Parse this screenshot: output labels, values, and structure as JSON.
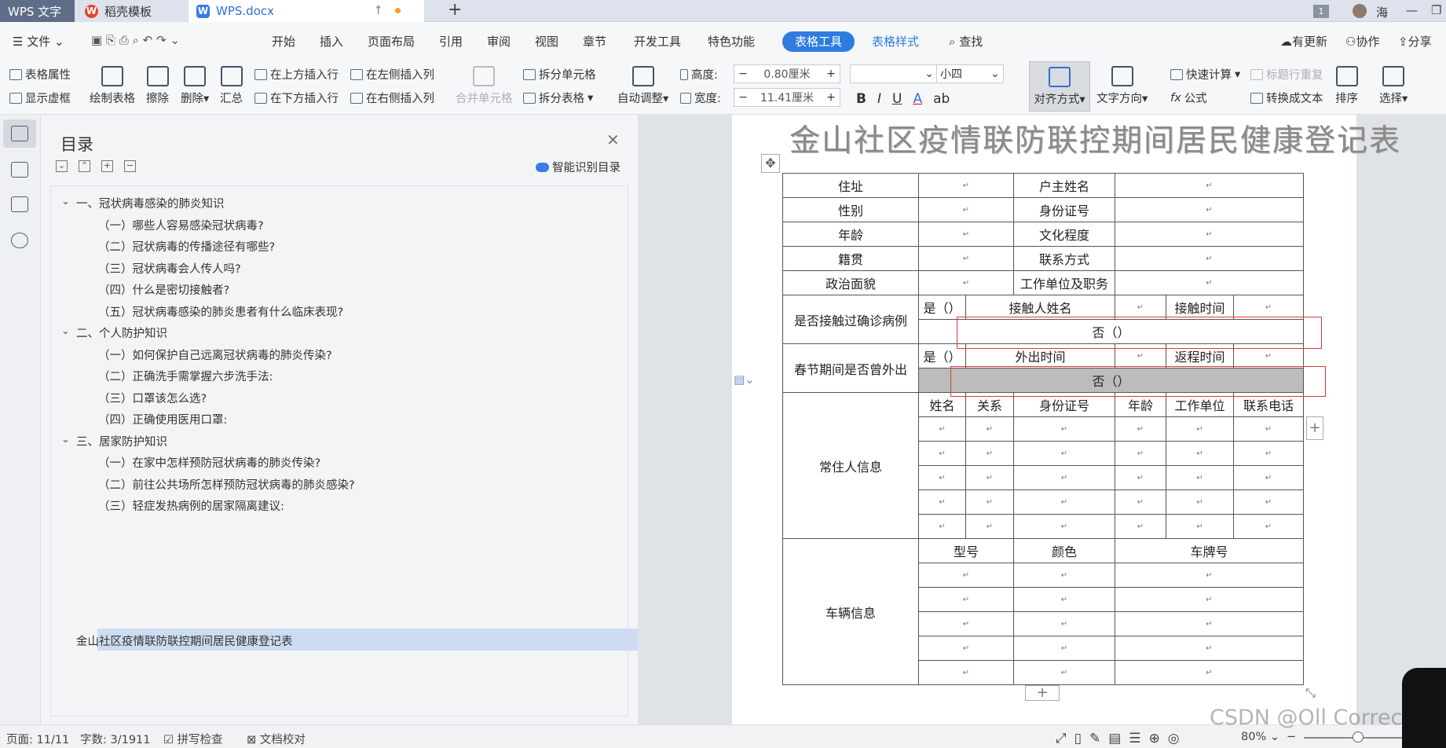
{
  "tabs": {
    "app": "WPS 文字",
    "template": "稻壳模板",
    "doc": "WPS.docx",
    "new_tab": "+",
    "badge": "1",
    "user": "海"
  },
  "menu": {
    "file": "文件",
    "items": [
      "开始",
      "插入",
      "页面布局",
      "引用",
      "审阅",
      "视图",
      "章节",
      "开发工具",
      "特色功能"
    ],
    "active": "表格工具",
    "style": "表格样式",
    "search": "查找",
    "update": "有更新",
    "collab": "协作",
    "share": "分享"
  },
  "ribbon": {
    "table_props": "表格属性",
    "show_grid": "显示虚框",
    "draw": "绘制表格",
    "erase": "擦除",
    "delete": "删除",
    "summary": "汇总",
    "ins_above": "在上方插入行",
    "ins_below": "在下方插入行",
    "ins_left": "在左侧插入列",
    "ins_right": "在右侧插入列",
    "merge": "合并单元格",
    "split_cell": "拆分单元格",
    "split_table": "拆分表格",
    "autofit": "自动调整",
    "height_label": "高度:",
    "height_val": "0.80厘米",
    "width_label": "宽度:",
    "width_val": "11.41厘米",
    "font_size": "小四",
    "align": "对齐方式",
    "text_dir": "文字方向",
    "quick_calc": "快速计算",
    "formula": "公式",
    "repeat_header": "标题行重复",
    "to_text": "转换成文本",
    "sort": "排序",
    "select": "选择"
  },
  "toc": {
    "title": "目录",
    "smart": "智能识别目录",
    "sections": [
      {
        "label": "一、冠状病毒感染的肺炎知识",
        "items": [
          "（一）哪些人容易感染冠状病毒?",
          "（二）冠状病毒的传播途径有哪些?",
          "（三）冠状病毒会人传人吗?",
          "（四）什么是密切接触者?",
          "（五）冠状病毒感染的肺炎患者有什么临床表现?"
        ]
      },
      {
        "label": "二、个人防护知识",
        "items": [
          "（一）如何保护自己远离冠状病毒的肺炎传染?",
          "（二）正确洗手需掌握六步洗手法:",
          "（三）口罩该怎么选?",
          "（四）正确使用医用口罩:"
        ]
      },
      {
        "label": "三、居家防护知识",
        "items": [
          "（一）在家中怎样预防冠状病毒的肺炎传染?",
          "（二）前往公共场所怎样预防冠状病毒的肺炎感染?",
          "（三）轻症发热病例的居家隔离建议:"
        ]
      }
    ],
    "selected": "金山社区疫情联防联控期间居民健康登记表"
  },
  "document": {
    "title": "金山社区疫情联防联控期间居民健康登记表",
    "mark": "↵",
    "rows": {
      "address": "住址",
      "head": "户主姓名",
      "gender": "性别",
      "id": "身份证号",
      "age": "年龄",
      "edu": "文化程度",
      "origin": "籍贯",
      "contact": "联系方式",
      "political": "政治面貌",
      "work": "工作单位及职务"
    },
    "contact_q": "是否接触过确诊病例",
    "yes": "是（）",
    "no": "否（）",
    "contact_name": "接触人姓名",
    "contact_time": "接触时间",
    "travel_q": "春节期间是否曾外出",
    "out_time": "外出时间",
    "back_time": "返程时间",
    "resident": "常住人信息",
    "res_cols": [
      "姓名",
      "关系",
      "身份证号",
      "年龄",
      "工作单位",
      "联系电话"
    ],
    "vehicle": "车辆信息",
    "veh_cols": [
      "型号",
      "颜色",
      "车牌号"
    ]
  },
  "status": {
    "page": "页面: 11/11",
    "words": "字数: 3/1911",
    "spell": "拼写检查",
    "proof": "文档校对",
    "zoom": "80%",
    "watermark": "CSDN @Oll Correct"
  }
}
